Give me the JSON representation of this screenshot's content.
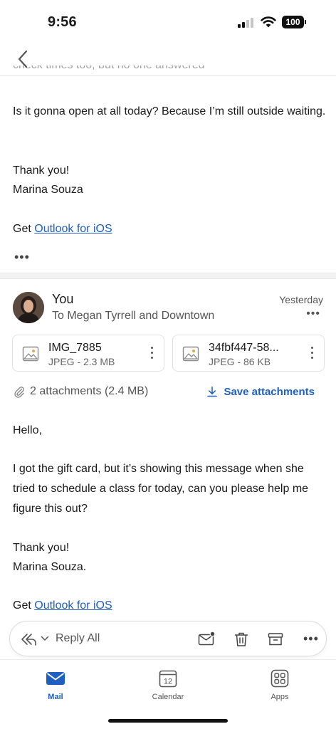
{
  "status": {
    "time": "9:56",
    "battery": "100"
  },
  "previous_message": {
    "cutoff_line": "check times too, but no one answered",
    "paragraph": "Is it gonna open at all today? Because I’m still outside waiting.",
    "thanks": "Thank you!",
    "signature": "Marina Souza",
    "get_prefix": "Get",
    "outlook_link": "Outlook for iOS",
    "more": "•••"
  },
  "message": {
    "sender": "You",
    "recipients": "To Megan Tyrrell and Downtown",
    "date": "Yesterday",
    "more": "•••",
    "attachments": [
      {
        "name": "IMG_7885",
        "meta": "JPEG - 2.3 MB"
      },
      {
        "name": "34fbf447-58...",
        "meta": "JPEG - 86 KB"
      }
    ],
    "attachments_summary": "2 attachments (2.4 MB)",
    "save_attachments": "Save attachments",
    "greeting": "Hello,",
    "paragraph": "I got the gift card, but it’s showing this message when she tried to schedule a class for today, can you please help me figure this out?",
    "thanks": "Thank you!",
    "signature": "Marina Souza.",
    "get_prefix": "Get",
    "outlook_link": "Outlook for iOS"
  },
  "reply_bar": {
    "label": "Reply All",
    "more": "•••"
  },
  "tabs": [
    {
      "label": "Mail",
      "icon": "mail-icon",
      "active": true
    },
    {
      "label": "Calendar",
      "icon": "calendar-icon",
      "day": "12"
    },
    {
      "label": "Apps",
      "icon": "apps-icon"
    }
  ],
  "colors": {
    "accent": "#1f5fbf",
    "link": "#1f5fbf"
  }
}
